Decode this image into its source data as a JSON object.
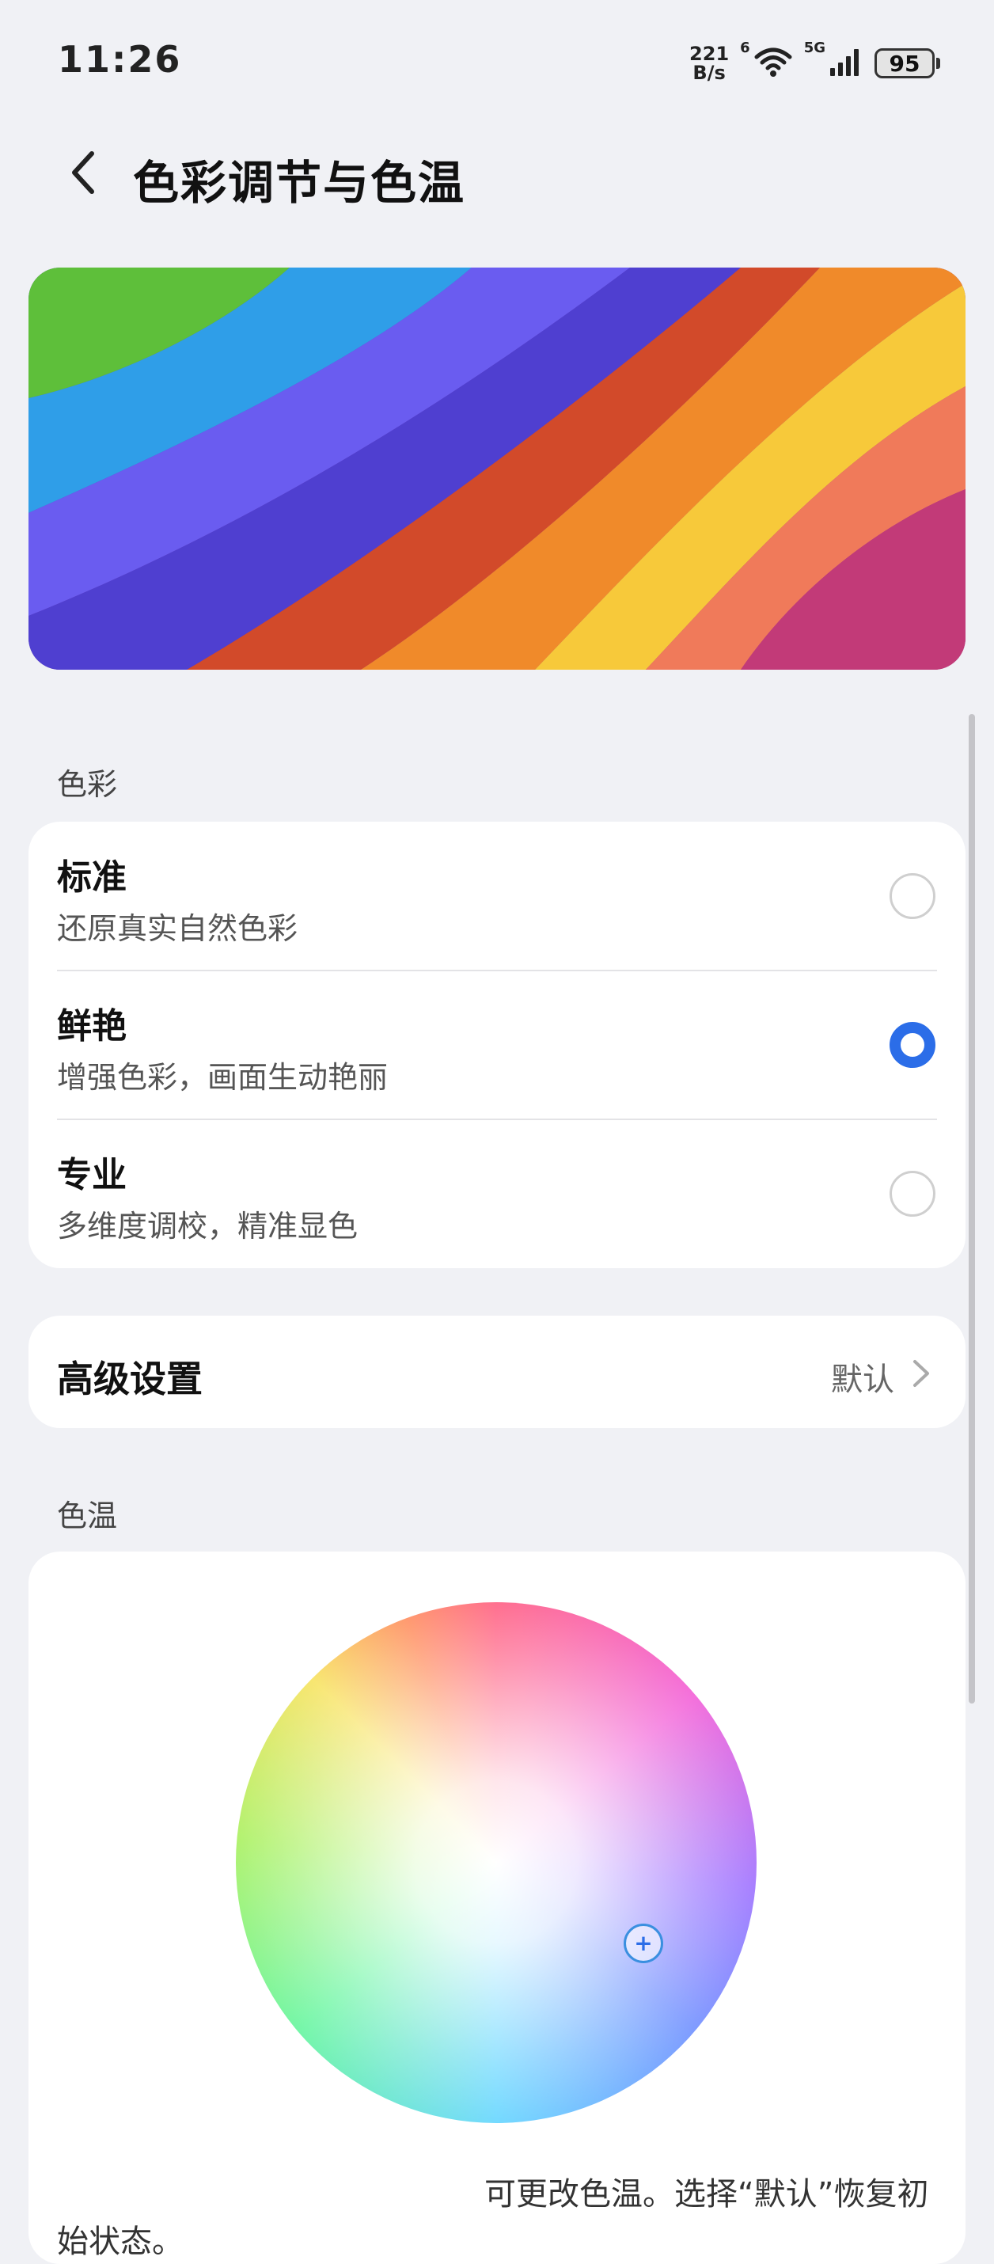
{
  "status_bar": {
    "time": "11:26",
    "net_speed_value": "221",
    "net_speed_unit": "B/s",
    "wifi_label": "6",
    "cell_label": "5G",
    "battery": "95"
  },
  "header": {
    "title": "色彩调节与色温"
  },
  "color_section": {
    "label": "色彩",
    "options": [
      {
        "title": "标准",
        "subtitle": "还原真实自然色彩",
        "selected": false
      },
      {
        "title": "鲜艳",
        "subtitle": "增强色彩，画面生动艳丽",
        "selected": true
      },
      {
        "title": "专业",
        "subtitle": "多维度调校，精准显色",
        "selected": false
      }
    ]
  },
  "advanced": {
    "title": "高级设置",
    "value": "默认"
  },
  "temperature_section": {
    "label": "色温",
    "description": "可更改色温。选择“默认”恢复初始状态。"
  },
  "colors": {
    "accent": "#2b6de8",
    "background": "#f0f1f5",
    "card": "#ffffff"
  }
}
